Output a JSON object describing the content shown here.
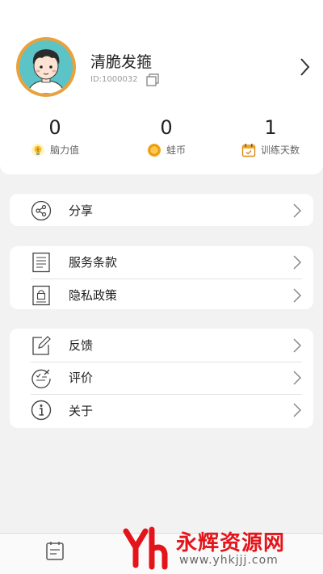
{
  "profile": {
    "username": "清脆发箍",
    "user_id": "ID:1000032"
  },
  "stats": [
    {
      "value": "0",
      "label": "脑力值",
      "icon": "lightbulb-icon"
    },
    {
      "value": "0",
      "label": "蛙币",
      "icon": "coin-icon"
    },
    {
      "value": "1",
      "label": "训练天数",
      "icon": "calendar-icon"
    }
  ],
  "menu": {
    "share": {
      "label": "分享",
      "icon": "share-icon"
    },
    "terms": {
      "label": "服务条款",
      "icon": "document-icon"
    },
    "privacy": {
      "label": "隐私政策",
      "icon": "lock-document-icon"
    },
    "feedback": {
      "label": "反馈",
      "icon": "edit-icon"
    },
    "rating": {
      "label": "评价",
      "icon": "rating-icon"
    },
    "about": {
      "label": "关于",
      "icon": "info-icon"
    }
  },
  "watermark": {
    "title": "永辉资源网",
    "url": "www.yhkjjj.com"
  },
  "colors": {
    "avatar_ring": "#e8a23d",
    "avatar_bg": "#5cc3c6",
    "coin": "#f2a41b",
    "watermark": "#e4151a"
  }
}
